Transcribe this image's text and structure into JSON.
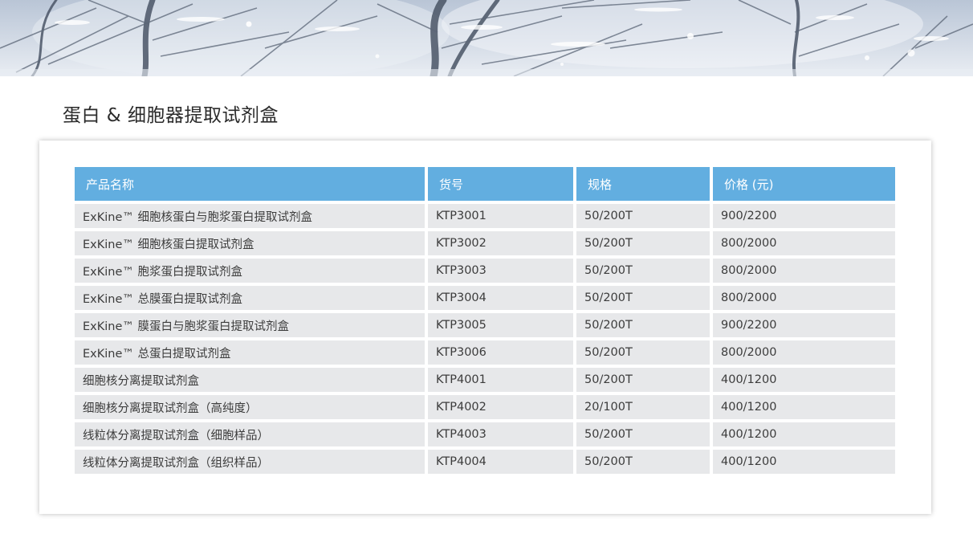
{
  "page": {
    "title": "蛋白 & 细胞器提取试剂盒"
  },
  "banner": {
    "description_icon": "snowy-trees-banner"
  },
  "table": {
    "headers": [
      "产品名称",
      "货号",
      "规格",
      "价格 (元)"
    ],
    "rows": [
      [
        "ExKine™ 细胞核蛋白与胞浆蛋白提取试剂盒",
        "KTP3001",
        "50/200T",
        "900/2200"
      ],
      [
        "ExKine™ 细胞核蛋白提取试剂盒",
        "KTP3002",
        "50/200T",
        "800/2000"
      ],
      [
        "ExKine™ 胞浆蛋白提取试剂盒",
        "KTP3003",
        "50/200T",
        "800/2000"
      ],
      [
        "ExKine™ 总膜蛋白提取试剂盒",
        "KTP3004",
        "50/200T",
        "800/2000"
      ],
      [
        "ExKine™ 膜蛋白与胞浆蛋白提取试剂盒",
        "KTP3005",
        "50/200T",
        "900/2200"
      ],
      [
        "ExKine™ 总蛋白提取试剂盒",
        "KTP3006",
        "50/200T",
        "800/2000"
      ],
      [
        "细胞核分离提取试剂盒",
        "KTP4001",
        "50/200T",
        "400/1200"
      ],
      [
        "细胞核分离提取试剂盒（高纯度）",
        "KTP4002",
        "20/100T",
        "400/1200"
      ],
      [
        "线粒体分离提取试剂盒（细胞样品）",
        "KTP4003",
        "50/200T",
        "400/1200"
      ],
      [
        "线粒体分离提取试剂盒（组织样品）",
        "KTP4004",
        "50/200T",
        "400/1200"
      ]
    ]
  },
  "colors": {
    "header_bg": "#62aee0",
    "row_bg": "#e7e8ea",
    "title_text": "#2b2b2b"
  }
}
